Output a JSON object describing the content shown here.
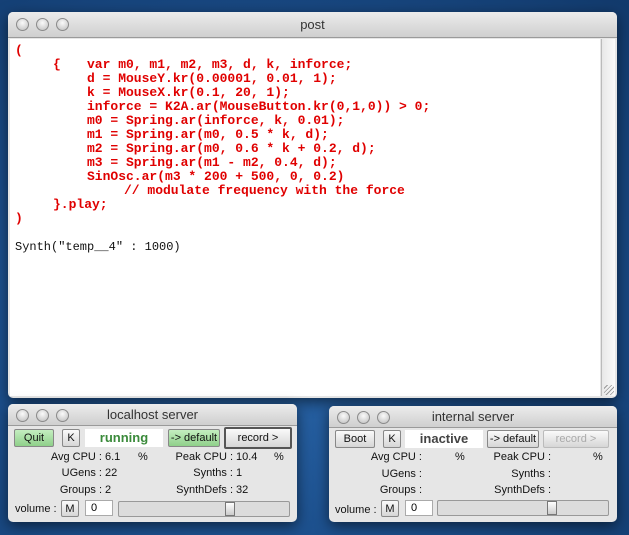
{
  "post": {
    "title": "post",
    "code_lines": [
      "(",
      "{",
      "var m0, m1, m2, m3, d, k, inforce;",
      "d = MouseY.kr(0.00001, 0.01, 1);",
      "k = MouseX.kr(0.1, 20, 1);",
      "inforce = K2A.ar(MouseButton.kr(0,1,0)) > 0;",
      "m0 = Spring.ar(inforce, k, 0.01);",
      "m1 = Spring.ar(m0, 0.5 * k, d);",
      "m2 = Spring.ar(m0, 0.6 * k + 0.2, d);",
      "m3 = Spring.ar(m1 - m2, 0.4, d);",
      "SinOsc.ar(m3 * 200 + 500, 0, 0.2)",
      "// modulate frequency with the force",
      "}.play;",
      ")"
    ],
    "output": "Synth(\"temp__4\" : 1000)"
  },
  "localhost": {
    "title": "localhost server",
    "boot_label": "Quit",
    "k_label": "K",
    "status": "running",
    "status_color": "#3a8a3a",
    "default_label": "-> default",
    "record_label": "record >",
    "avg_cpu_label": "Avg CPU :",
    "avg_cpu": "6.1",
    "pct": "%",
    "peak_cpu_label": "Peak CPU :",
    "peak_cpu": "10.4",
    "ugens_label": "UGens :",
    "ugens": "22",
    "synths_label": "Synths :",
    "synths": "1",
    "groups_label": "Groups :",
    "groups": "2",
    "synthdefs_label": "SynthDefs :",
    "synthdefs": "32",
    "volume_label": "volume :",
    "mute_label": "M",
    "volume": "0",
    "volume_fraction": 0.66
  },
  "internal": {
    "title": "internal server",
    "boot_label": "Boot",
    "k_label": "K",
    "status": "inactive",
    "status_color": "#444444",
    "default_label": "-> default",
    "record_label": "record >",
    "avg_cpu_label": "Avg CPU :",
    "avg_cpu": "",
    "pct": "%",
    "peak_cpu_label": "Peak CPU :",
    "peak_cpu": "",
    "ugens_label": "UGens :",
    "ugens": "",
    "synths_label": "Synths :",
    "synths": "",
    "groups_label": "Groups :",
    "groups": "",
    "synthdefs_label": "SynthDefs :",
    "synthdefs": "",
    "volume_label": "volume :",
    "mute_label": "M",
    "volume": "0",
    "volume_fraction": 0.68
  }
}
